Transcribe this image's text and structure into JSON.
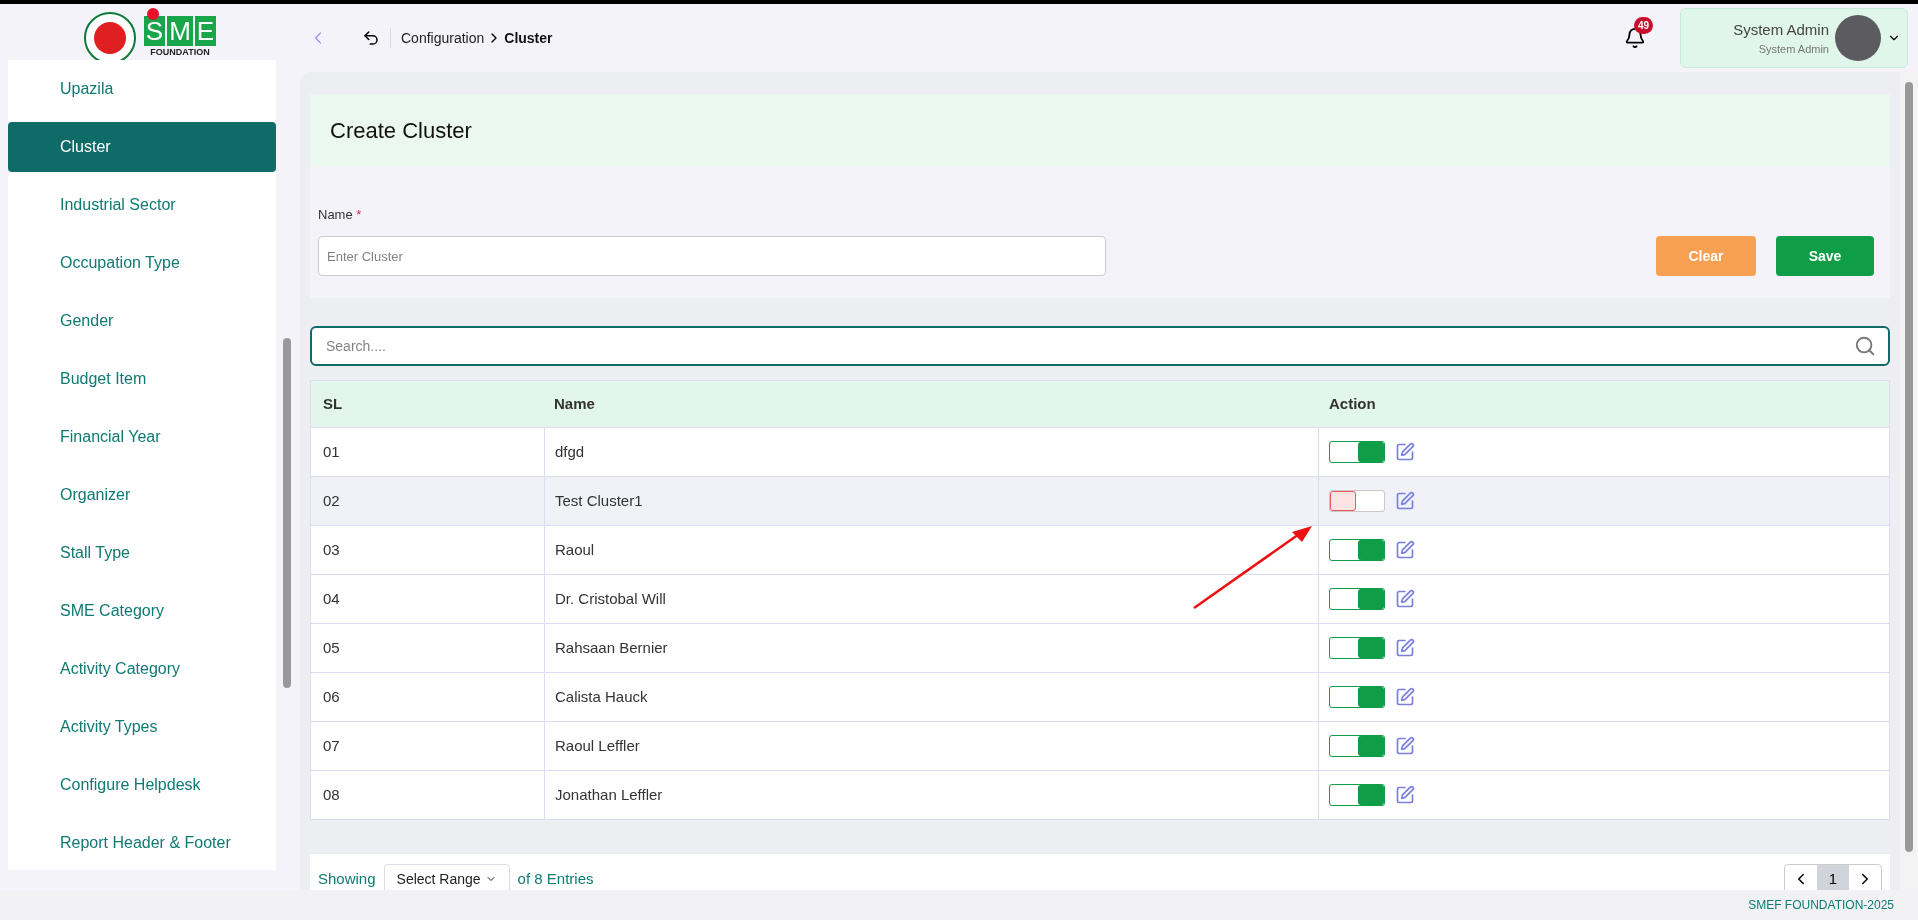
{
  "logo": {
    "letters": "SME",
    "subtitle": "FOUNDATION"
  },
  "breadcrumb": {
    "parent": "Configuration",
    "current": "Cluster"
  },
  "notifications": {
    "count": "49"
  },
  "user": {
    "name": "System Admin",
    "role": "System Admin"
  },
  "sidebar": {
    "items": [
      {
        "label": "Upazila",
        "selected": false
      },
      {
        "label": "Cluster",
        "selected": true
      },
      {
        "label": "Industrial Sector",
        "selected": false
      },
      {
        "label": "Occupation Type",
        "selected": false
      },
      {
        "label": "Gender",
        "selected": false
      },
      {
        "label": "Budget Item",
        "selected": false
      },
      {
        "label": "Financial Year",
        "selected": false
      },
      {
        "label": "Organizer",
        "selected": false
      },
      {
        "label": "Stall Type",
        "selected": false
      },
      {
        "label": "SME Category",
        "selected": false
      },
      {
        "label": "Activity Category",
        "selected": false
      },
      {
        "label": "Activity Types",
        "selected": false
      },
      {
        "label": "Configure Helpdesk",
        "selected": false
      },
      {
        "label": "Report Header & Footer",
        "selected": false
      }
    ]
  },
  "form": {
    "title": "Create Cluster",
    "field_label": "Name",
    "required_mark": "*",
    "placeholder": "Enter Cluster",
    "clear": "Clear",
    "save": "Save"
  },
  "search": {
    "placeholder": "Search...."
  },
  "table": {
    "columns": [
      "SL",
      "Name",
      "Action"
    ],
    "rows": [
      {
        "sl": "01",
        "name": "dfgd",
        "on": true,
        "selected": false
      },
      {
        "sl": "02",
        "name": "Test Cluster1",
        "on": false,
        "selected": true
      },
      {
        "sl": "03",
        "name": "Raoul",
        "on": true,
        "selected": false
      },
      {
        "sl": "04",
        "name": "Dr. Cristobal Will",
        "on": true,
        "selected": false
      },
      {
        "sl": "05",
        "name": "Rahsaan Bernier",
        "on": true,
        "selected": false
      },
      {
        "sl": "06",
        "name": "Calista Hauck",
        "on": true,
        "selected": false
      },
      {
        "sl": "07",
        "name": "Raoul Leffler",
        "on": true,
        "selected": false
      },
      {
        "sl": "08",
        "name": "Jonathan Leffler",
        "on": true,
        "selected": false
      }
    ]
  },
  "pagination": {
    "showing": "Showing",
    "range": "Select Range",
    "total": "of 8 Entries",
    "pages": [
      {
        "label": "1",
        "selected": true
      }
    ]
  },
  "footer": "SMEF FOUNDATION-2025"
}
